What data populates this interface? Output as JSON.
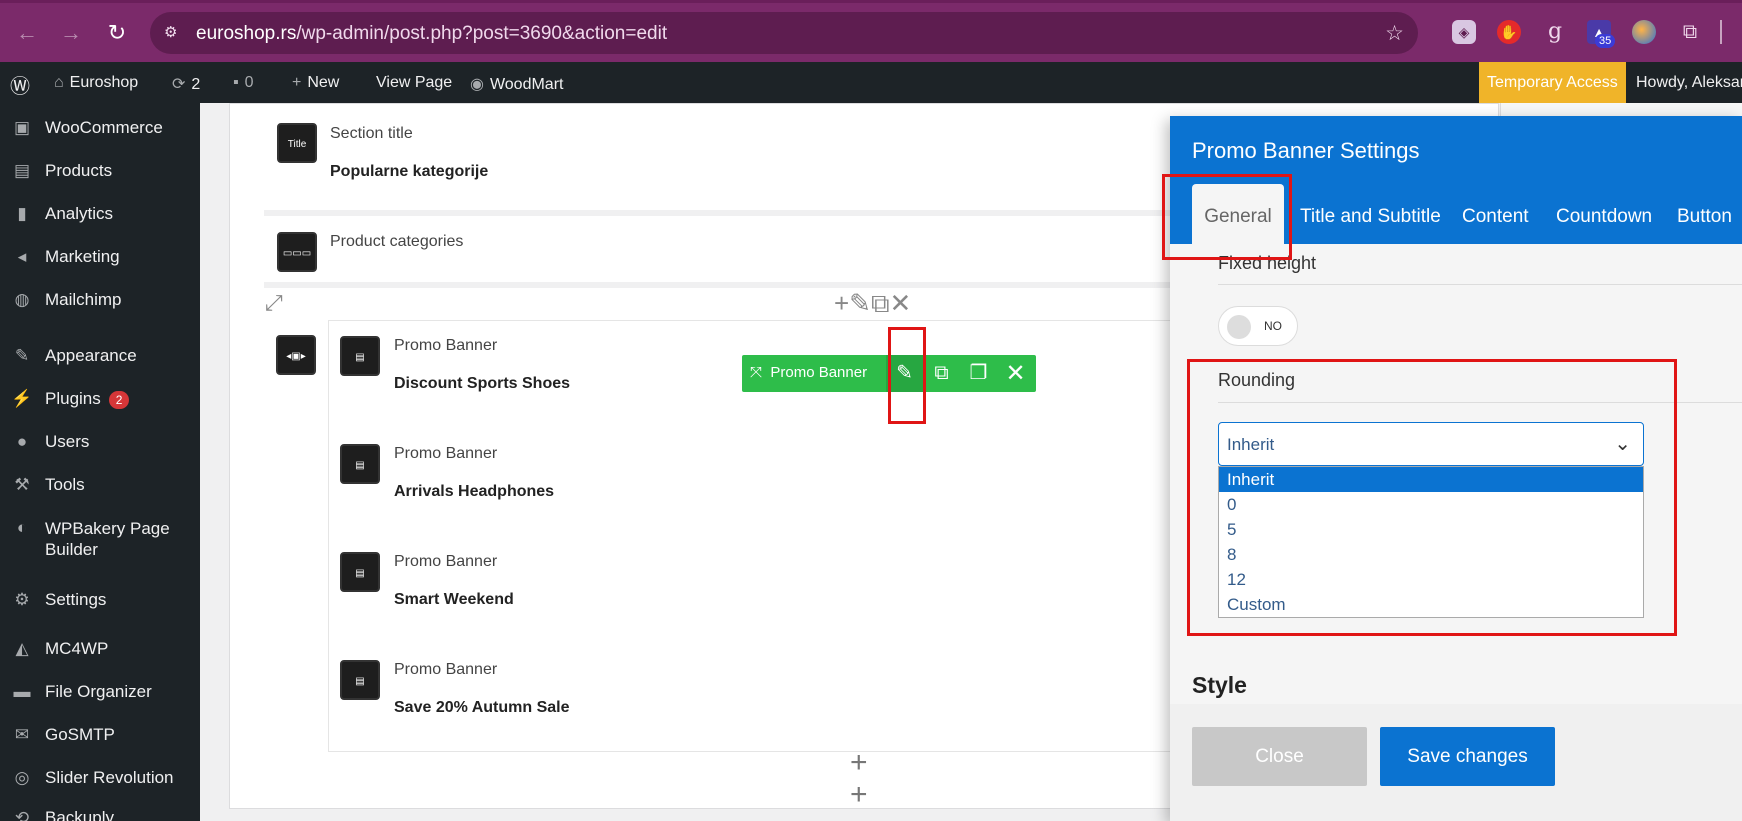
{
  "browser": {
    "url_domain": "euroshop.rs",
    "url_path": "/wp-admin/post.php?post=3690&action=edit",
    "ext_badge": "35"
  },
  "adminbar": {
    "site_name": "Euroshop",
    "updates_count": "2",
    "comments_count": "0",
    "new_label": "New",
    "view_page": "View Page",
    "woodmart": "WoodMart",
    "temporary_access": "Temporary Access",
    "howdy": "Howdy, Aleksan"
  },
  "sidebar": {
    "items": [
      {
        "label": "WooCommerce",
        "icon": "woo-icon"
      },
      {
        "label": "Products",
        "icon": "products-icon"
      },
      {
        "label": "Analytics",
        "icon": "analytics-icon"
      },
      {
        "label": "Marketing",
        "icon": "megaphone-icon"
      },
      {
        "label": "Mailchimp",
        "icon": "mailchimp-icon"
      },
      {
        "label": "Appearance",
        "icon": "brush-icon"
      },
      {
        "label": "Plugins",
        "icon": "plug-icon",
        "badge": "2"
      },
      {
        "label": "Users",
        "icon": "user-icon"
      },
      {
        "label": "Tools",
        "icon": "wrench-icon"
      },
      {
        "label": "WPBakery Page",
        "label2": "Builder",
        "icon": "wpbakery-icon"
      },
      {
        "label": "Settings",
        "icon": "settings-icon"
      },
      {
        "label": "MC4WP",
        "icon": "mc4wp-icon"
      },
      {
        "label": "File Organizer",
        "icon": "folder-icon"
      },
      {
        "label": "GoSMTP",
        "icon": "mail-icon"
      },
      {
        "label": "Slider Revolution",
        "icon": "slider-icon"
      },
      {
        "label": "Backuply",
        "icon": "backup-icon"
      }
    ]
  },
  "editor": {
    "section_title": {
      "name": "Section title",
      "value": "Popularne kategorije",
      "icon_text": "Title"
    },
    "product_categories": {
      "name": "Product categories"
    },
    "banners": [
      {
        "name": "Promo Banner",
        "value": "Discount Sports Shoes"
      },
      {
        "name": "Promo Banner",
        "value": "Arrivals Headphones"
      },
      {
        "name": "Promo Banner",
        "value": "Smart Weekend"
      },
      {
        "name": "Promo Banner",
        "value": "Save 20% Autumn Sale"
      }
    ],
    "toolbar_label": "Promo Banner"
  },
  "modal": {
    "title": "Promo Banner Settings",
    "tabs": [
      "General",
      "Title and Subtitle",
      "Content",
      "Countdown",
      "Button"
    ],
    "fixed_height_label": "Fixed height",
    "toggle_text": "NO",
    "rounding_label": "Rounding",
    "rounding_selected": "Inherit",
    "rounding_options": [
      "Inherit",
      "0",
      "5",
      "8",
      "12",
      "Custom"
    ],
    "style_title": "Style",
    "close_label": "Close",
    "save_label": "Save changes"
  },
  "colors": {
    "browser_bar": "#7b2a6a",
    "wp_dark": "#1d2327",
    "modal_blue": "#0b73d1",
    "toolbar_green": "#2ebd4a",
    "highlight_red": "#e01515",
    "temp_access": "#f0b429"
  }
}
